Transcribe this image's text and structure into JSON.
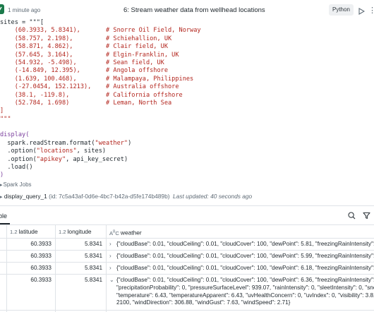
{
  "header": {
    "time_ago": "1 minute ago",
    "cell_title": "6:  Stream weather data from wellhead locations",
    "language": "Python"
  },
  "code_lines": [
    [
      {
        "t": "sites = \"\"\"[",
        "c": "c-var"
      }
    ],
    [
      {
        "t": "    (60.3933, 5.8341),       ",
        "c": "c-str"
      },
      {
        "t": "# Snorre Oil Field, Norway",
        "c": "c-com"
      }
    ],
    [
      {
        "t": "    (58.757, 2.198),         ",
        "c": "c-str"
      },
      {
        "t": "# Schiehallion, UK",
        "c": "c-com"
      }
    ],
    [
      {
        "t": "    (58.871, 4.862),         ",
        "c": "c-str"
      },
      {
        "t": "# Clair field, UK",
        "c": "c-com"
      }
    ],
    [
      {
        "t": "    (57.645, 3.164),         ",
        "c": "c-str"
      },
      {
        "t": "# Elgin-Franklin, UK",
        "c": "c-com"
      }
    ],
    [
      {
        "t": "    (54.932, -5.498),        ",
        "c": "c-str"
      },
      {
        "t": "# Sean field, UK",
        "c": "c-com"
      }
    ],
    [
      {
        "t": "    (-14.849, 12.395),       ",
        "c": "c-str"
      },
      {
        "t": "# Angola offshore",
        "c": "c-com"
      }
    ],
    [
      {
        "t": "    (1.639, 100.468),        ",
        "c": "c-str"
      },
      {
        "t": "# Malampaya, Philippines",
        "c": "c-com"
      }
    ],
    [
      {
        "t": "    (-27.0454, 152.1213),    ",
        "c": "c-str"
      },
      {
        "t": "# Australia offshore",
        "c": "c-com"
      }
    ],
    [
      {
        "t": "    (38.1, -119.8),          ",
        "c": "c-str"
      },
      {
        "t": "# California offshore",
        "c": "c-com"
      }
    ],
    [
      {
        "t": "    (52.784, 1.698)          ",
        "c": "c-str"
      },
      {
        "t": "# Leman, North Sea",
        "c": "c-com"
      }
    ],
    [
      {
        "t": "]",
        "c": "c-str"
      }
    ],
    [
      {
        "t": "\"\"\"",
        "c": "c-str"
      }
    ],
    [
      {
        "t": "",
        "c": "c-var"
      }
    ],
    [
      {
        "t": "display(",
        "c": "c-fn"
      }
    ],
    [
      {
        "t": "  spark.readStream.format(",
        "c": "c-var"
      },
      {
        "t": "\"weather\"",
        "c": "c-str"
      },
      {
        "t": ")",
        "c": "c-var"
      }
    ],
    [
      {
        "t": "  .option(",
        "c": "c-var"
      },
      {
        "t": "\"locations\"",
        "c": "c-str"
      },
      {
        "t": ", sites)",
        "c": "c-var"
      }
    ],
    [
      {
        "t": "  .option(",
        "c": "c-var"
      },
      {
        "t": "\"apikey\"",
        "c": "c-str"
      },
      {
        "t": ", api_key_secret)",
        "c": "c-var"
      }
    ],
    [
      {
        "t": "  .load()",
        "c": "c-var"
      }
    ],
    [
      {
        "t": ")",
        "c": "c-fn"
      }
    ]
  ],
  "spark_jobs": "Spark Jobs",
  "stream": {
    "name": "display_query_1",
    "id": "(id: 7c5a43af-0d6e-4bc7-b42a-d5fe174b489b)",
    "updated": "Last updated: 40 seconds ago"
  },
  "table_tab": "ble",
  "columns": [
    {
      "type": "",
      "label": ""
    },
    {
      "type": "1.2",
      "label": "latitude"
    },
    {
      "type": "1.2",
      "label": "longitude"
    },
    {
      "type": "A̲B",
      "label": "weather"
    }
  ],
  "rows": [
    {
      "latitude": "60.3933",
      "longitude": "5.8341",
      "expanded": false,
      "weather": [
        "{\"cloudBase\": 0.01, \"cloudCeiling\": 0.01, \"cloudCover\": 100, \"dewPoint\": 5.81, \"freezingRainIntensity\": 0, \"h"
      ]
    },
    {
      "latitude": "60.3933",
      "longitude": "5.8341",
      "expanded": false,
      "weather": [
        "{\"cloudBase\": 0.01, \"cloudCeiling\": 0.01, \"cloudCover\": 100, \"dewPoint\": 5.99, \"freezingRainIntensity\": 0, \"h"
      ]
    },
    {
      "latitude": "60.3933",
      "longitude": "5.8341",
      "expanded": false,
      "weather": [
        "{\"cloudBase\": 0.01, \"cloudCeiling\": 0.01, \"cloudCover\": 100, \"dewPoint\": 6.18, \"freezingRainIntensity\": 0, \"h"
      ]
    },
    {
      "latitude": "60.3933",
      "longitude": "5.8341",
      "expanded": true,
      "weather": [
        "{\"cloudBase\": 0.01, \"cloudCeiling\": 0.01, \"cloudCover\": 100, \"dewPoint\": 6.36, \"freezingRainIntensity\": 0, \"h",
        "\"precipitationProbability\": 0, \"pressureSurfaceLevel\": 939.07, \"rainIntensity\": 0, \"sleetIntensity\": 0, \"snowInte",
        "\"temperature\": 6.43, \"temperatureApparent\": 6.43, \"uvHealthConcern\": 0, \"uvIndex\": 0, \"visibility\": 3.8, \"wea",
        "2100, \"windDirection\": 306.88, \"windGust\": 7.63, \"windSpeed\": 2.71}"
      ]
    },
    {
      "latitude": "60.3933",
      "longitude": "5.8341",
      "expanded": false,
      "weather": [
        "{\"cloudBase\": 0.09, \"cloudCeiling\": 0.15, \"cloudCover\": 100, \"dewPoint\": 6.54, \"freezingRainIntensity\": 0, \"h"
      ]
    }
  ],
  "colors": {
    "accent_green": "#1b7a4a",
    "string_red": "#b3261e"
  }
}
